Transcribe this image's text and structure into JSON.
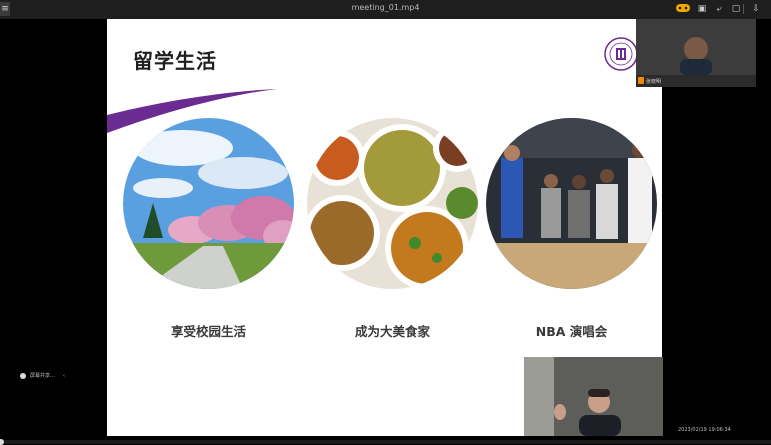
{
  "window": {
    "title": "meeting_01.mp4",
    "menu_glyph": "≡",
    "toolbar_glyphs": [
      "▣",
      "⤶",
      "▢",
      "⇩"
    ]
  },
  "slide": {
    "title": "留学生活",
    "accent_color": "#6a2c91",
    "items": [
      {
        "caption": "享受校园生活",
        "icon": "cherry-blossom-campus-photo"
      },
      {
        "caption": "成为大美食家",
        "icon": "homemade-dishes-photo"
      },
      {
        "caption": "NBA 演唱会",
        "icon": "nba-courtside-photo"
      }
    ]
  },
  "participant_top": {
    "name": "张晓明"
  },
  "status": {
    "left_text": "屏幕共享…",
    "timestamp": "2023/02/19 19:06:34"
  },
  "playback": {
    "progress": 0.0
  }
}
